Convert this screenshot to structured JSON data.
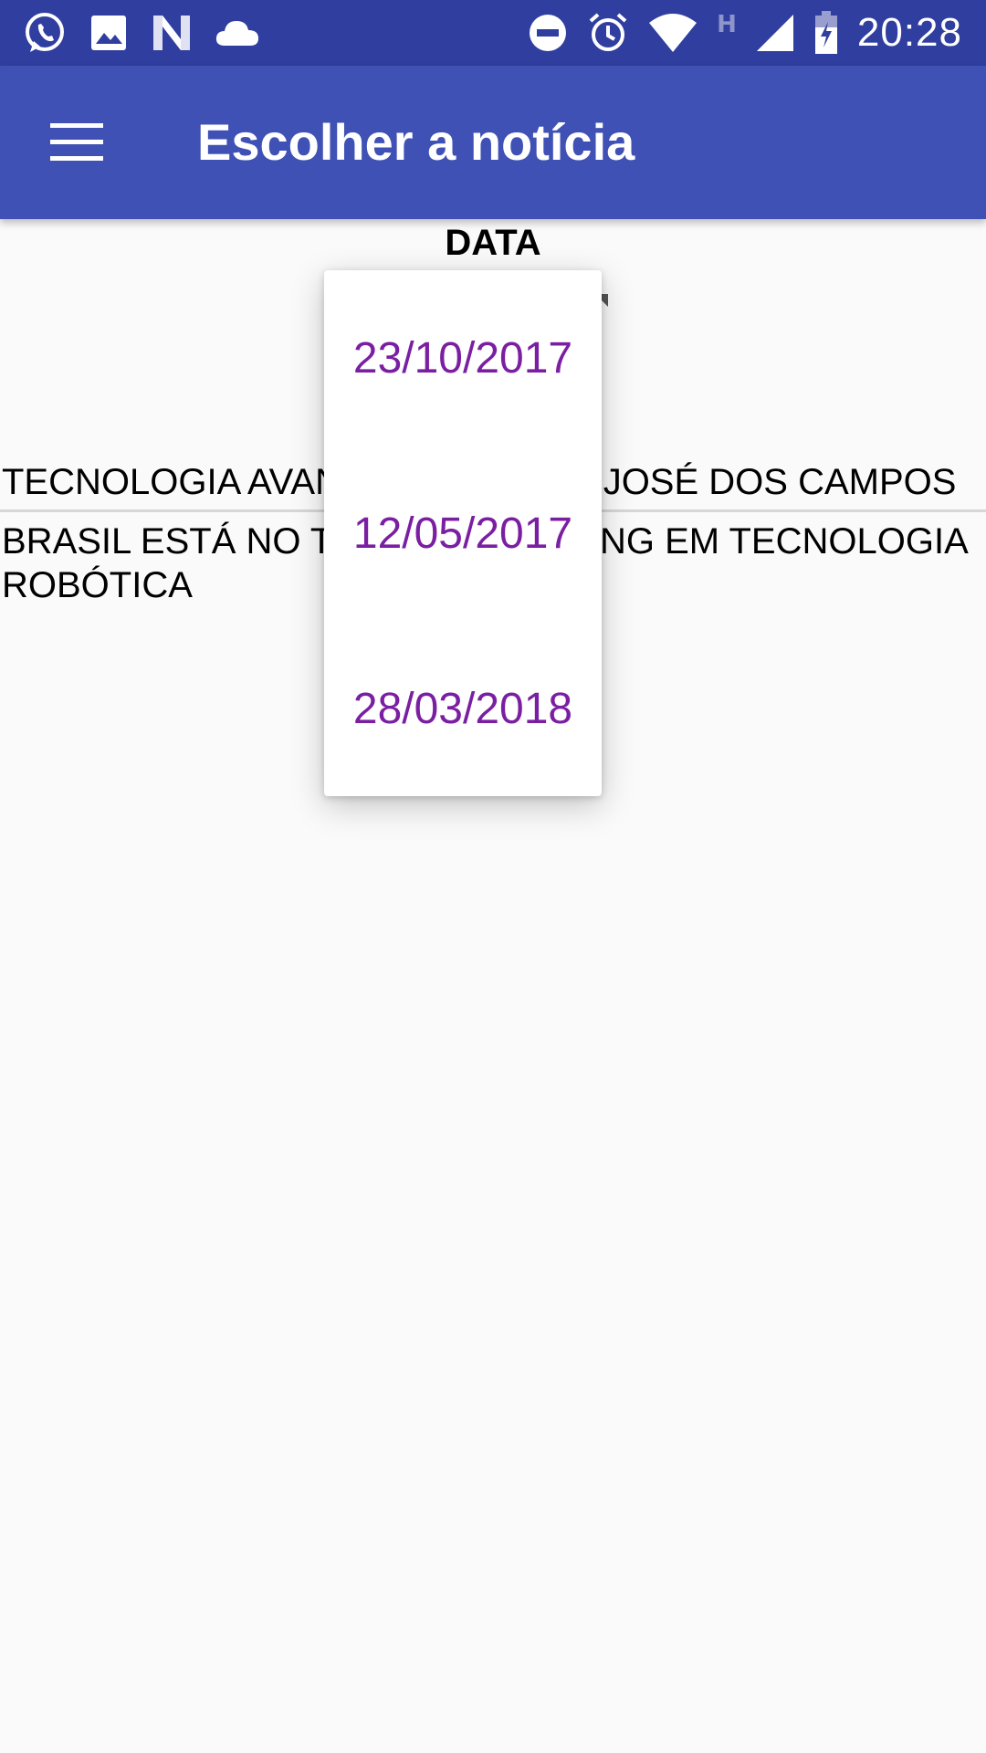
{
  "status_bar": {
    "left_icons": [
      "whatsapp-icon",
      "gallery-icon",
      "n-app-icon",
      "cloud-icon"
    ],
    "right_icons": [
      "do-not-disturb-icon",
      "alarm-icon",
      "wifi-icon",
      "network-h-icon",
      "signal-icon",
      "battery-charging-icon"
    ],
    "network_type": "H",
    "time": "20:28"
  },
  "app_bar": {
    "title": "Escolher a notícia",
    "menu_icon": "hamburger-menu-icon"
  },
  "filter": {
    "label": "DATA"
  },
  "news": [
    {
      "title": "TECNOLOGIA AVANÇADA EM SÃO JOSÉ DOS CAMPOS"
    },
    {
      "title": "BRASIL ESTÁ NO TOPO DO RANKING EM TECNOLOGIA ROBÓTICA"
    }
  ],
  "dropdown": {
    "options": [
      "23/10/2017",
      "12/05/2017",
      "28/03/2018"
    ]
  },
  "colors": {
    "status_bar": "#303f9f",
    "app_bar": "#3f51b5",
    "dropdown_text": "#7b1fa2",
    "background": "#fafafa"
  }
}
